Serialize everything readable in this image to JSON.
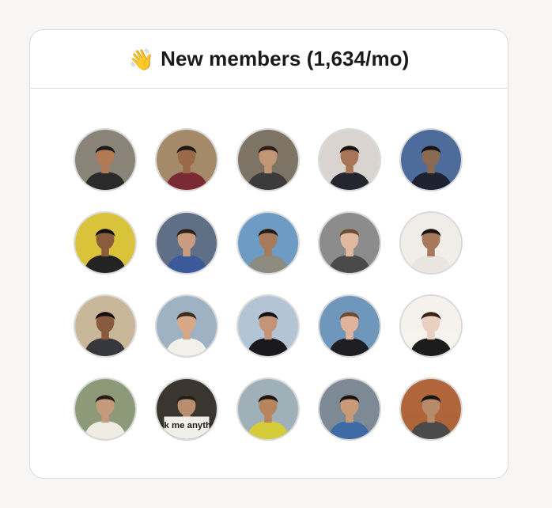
{
  "header": {
    "emoji": "👋",
    "title": "New members (1,634/mo)",
    "emoji_icon": "waving-hand-icon"
  },
  "members": [
    {
      "bg": "#8a8378",
      "skin": "#b07a55",
      "hair": "#1c1a18",
      "shirt": "#2a2a2a"
    },
    {
      "bg": "#a58a6a",
      "skin": "#9a6a48",
      "hair": "#1e1610",
      "shirt": "#7a2a32"
    },
    {
      "bg": "#7e7466",
      "skin": "#c29575",
      "hair": "#2a1c14",
      "shirt": "#3b3b3b"
    },
    {
      "bg": "#d9d4cf",
      "skin": "#a87556",
      "hair": "#18120e",
      "shirt": "#23262e"
    },
    {
      "bg": "#4d6c9c",
      "skin": "#8a6a52",
      "hair": "#161412",
      "shirt": "#1e2230"
    },
    {
      "bg": "#d9c33a",
      "skin": "#8a5c3c",
      "hair": "#141010",
      "shirt": "#232323"
    },
    {
      "bg": "#5f6f86",
      "skin": "#c89c7e",
      "hair": "#2a2018",
      "shirt": "#3c5a9a"
    },
    {
      "bg": "#6d9bc4",
      "skin": "#a77a5c",
      "hair": "#241a12",
      "shirt": "#8d8a80"
    },
    {
      "bg": "#8c8c8c",
      "skin": "#e0b9a0",
      "hair": "#6a4a30",
      "shirt": "#4a4a4a"
    },
    {
      "bg": "#f0ede8",
      "skin": "#a8785a",
      "hair": "#1a1410",
      "shirt": "#e9e6e0"
    },
    {
      "bg": "#c9b79a",
      "skin": "#8a5a3e",
      "hair": "#141010",
      "shirt": "#36383e"
    },
    {
      "bg": "#9fb2c4",
      "skin": "#d6a886",
      "hair": "#3a2a1c",
      "shirt": "#f2f0ea"
    },
    {
      "bg": "#b3c4d4",
      "skin": "#c49478",
      "hair": "#161412",
      "shirt": "#1a1a1e"
    },
    {
      "bg": "#6f96bb",
      "skin": "#e0b39a",
      "hair": "#6a4a30",
      "shirt": "#1e1e22"
    },
    {
      "bg": "#f5f2ee",
      "skin": "#ead0c0",
      "hair": "#3a2418",
      "shirt": "#1c1c1c"
    },
    {
      "bg": "#8c9a7a",
      "skin": "#c49a7c",
      "hair": "#2a1e14",
      "shirt": "#efece4"
    },
    {
      "bg": "#3a362f",
      "skin": "#b98d6e",
      "hair": "#26201a",
      "shirt": "#2e2e2e",
      "sign_text": "ask me anythin"
    },
    {
      "bg": "#9fb0b8",
      "skin": "#b8845e",
      "hair": "#1e1610",
      "shirt": "#d4cc3a"
    },
    {
      "bg": "#7d8a95",
      "skin": "#c99a78",
      "hair": "#1c1612",
      "shirt": "#3e6aa6"
    },
    {
      "bg": "#b0653a",
      "skin": "#b78a6a",
      "hair": "#1a1410",
      "shirt": "#4a4a4a"
    }
  ]
}
